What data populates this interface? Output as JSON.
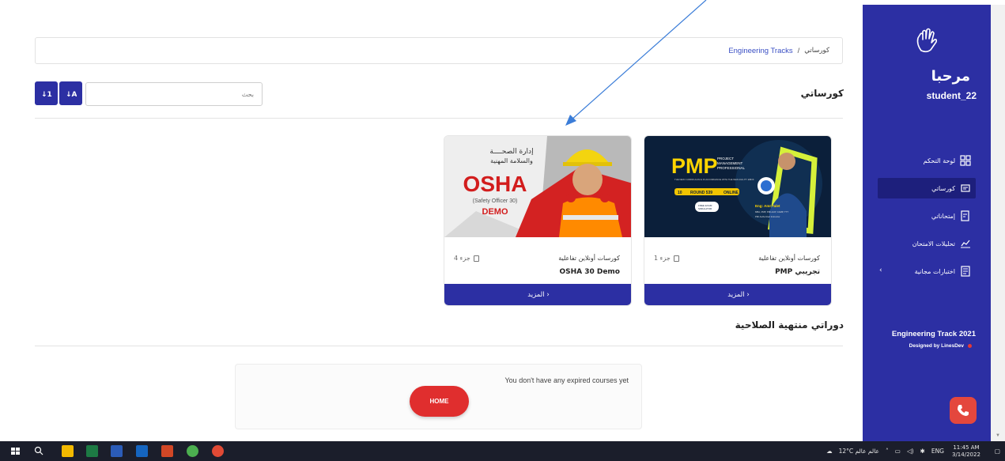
{
  "sidebar": {
    "greeting": "مرحبا",
    "username": "student_22",
    "items": [
      {
        "label": "لوحة التحكم"
      },
      {
        "label": "كورساتي"
      },
      {
        "label": "إمتحاناتي"
      },
      {
        "label": "تحليلات الامتحان"
      },
      {
        "label": "اختبارات مجانية",
        "chevron": "‹"
      }
    ],
    "brand": "Engineering Track 2021",
    "designed_by": "Designed by LinesDev"
  },
  "breadcrumb": {
    "link": "Engineering Tracks",
    "separator": "/",
    "current": "كورساتي"
  },
  "my_courses": {
    "title": "كورساتي",
    "search_placeholder": "بحث",
    "sort_asc": "1↓",
    "sort_desc": "1↑"
  },
  "courses": [
    {
      "category": "كورسات أونلاين تفاعلية",
      "count": "1 جزء",
      "name": "PMP تجريبي",
      "more": "المزيد ›",
      "thumb": {
        "big": "PMP",
        "sub1": "PROJECT",
        "sub2": "MANAGEMENT",
        "sub3": "PROFESSIONAL",
        "line": "THE NEW CURRICULUM & IN ACCORDANCE WITH THE NEW AGILITY EBOK",
        "tag1": "10",
        "tag2": "ROUND 539",
        "tag3": "ONLINE",
        "badge1": "FREE EXAM",
        "badge2": "SIMULATOR",
        "person": "Eng: Amr Talet",
        "creds": "MBA, PMP, PMI-ACP, CAMP, TTT",
        "role": "PMI Authorized Instructor"
      }
    },
    {
      "category": "كورسات أونلاين تفاعلية",
      "count": "4 جزء",
      "name": "OSHA 30 Demo",
      "more": "المزيد ›",
      "thumb": {
        "ar1": "إدارة الصحــــة",
        "ar2": "والسلامة المهنية",
        "big": "OSHA",
        "sub": "(Safety Officer 30)",
        "demo": "DEMO"
      }
    }
  ],
  "expired": {
    "title": "دوراتي منتهية الصلاحية",
    "message": "You don't have any expired courses yet",
    "home_label": "HOME"
  },
  "taskbar": {
    "weather": "12°C عالم عالم",
    "lang": "ENG",
    "time": "11:45 AM",
    "date": "3/14/2022"
  },
  "colors": {
    "primary": "#2c2fa3",
    "accent_red": "#e02e2e",
    "taskbar": "#1b1e2b"
  }
}
